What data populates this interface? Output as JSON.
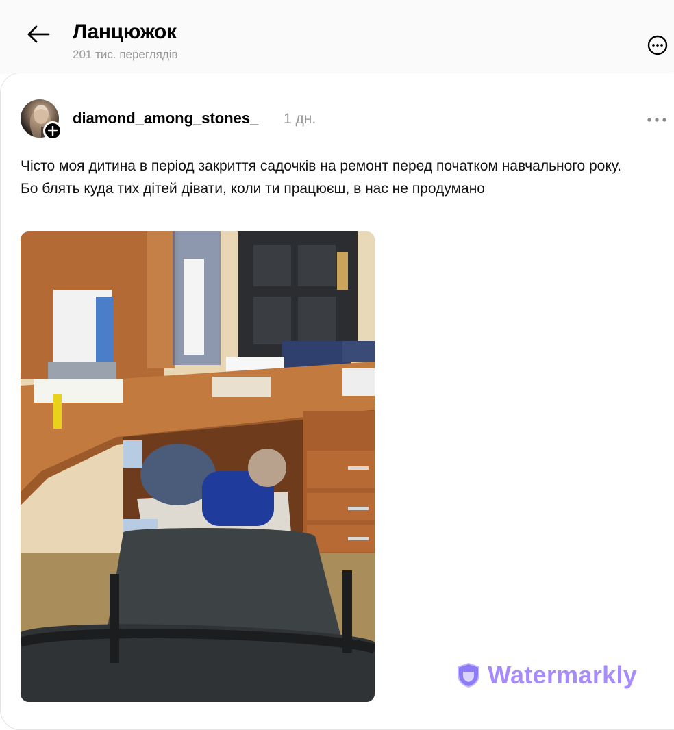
{
  "header": {
    "title": "Ланцюжок",
    "subtitle": "201 тис. переглядів",
    "back_icon": "arrow-left-icon",
    "more_icon": "more-circle-icon"
  },
  "post": {
    "username": "diamond_among_stones_",
    "time": "1 дн.",
    "text": "Чісто моя дитина в період закриття садочків на ремонт перед початком навчального року. Бо блять куда тих дітей дівати, коли ти працюєш, в нас не продумано",
    "more_icon": "ellipsis-icon",
    "follow_icon": "plus-icon"
  },
  "watermark": {
    "label": "Watermarkly",
    "icon": "shield-icon",
    "color": "#a78bfa"
  }
}
